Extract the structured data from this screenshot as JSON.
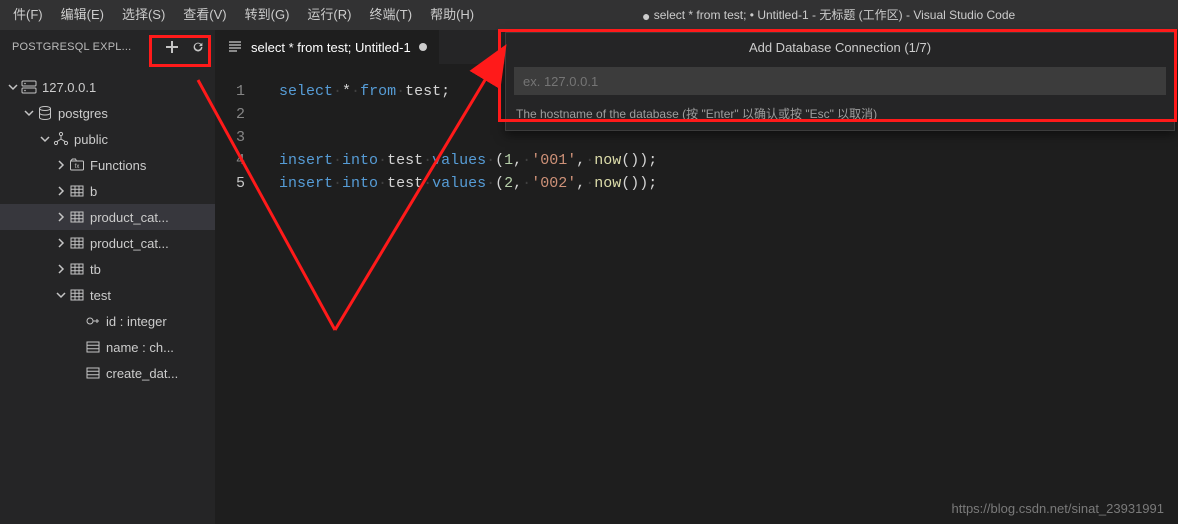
{
  "menubar": {
    "items": [
      "件(F)",
      "编辑(E)",
      "选择(S)",
      "查看(V)",
      "转到(G)",
      "运行(R)",
      "终端(T)",
      "帮助(H)"
    ],
    "title_prefix": "●",
    "title": "select * from test; • Untitled-1 - 无标题 (工作区) - Visual Studio Code"
  },
  "sidebar": {
    "panel_title": "POSTGRESQL EXPL...",
    "add_icon": "plus-icon",
    "tree": [
      {
        "depth": 0,
        "twisty": "down",
        "icon": "server",
        "label": "127.0.0.1"
      },
      {
        "depth": 1,
        "twisty": "down",
        "icon": "database",
        "label": "postgres"
      },
      {
        "depth": 2,
        "twisty": "down",
        "icon": "schema",
        "label": "public"
      },
      {
        "depth": 3,
        "twisty": "right",
        "icon": "folder-fn",
        "label": "Functions"
      },
      {
        "depth": 3,
        "twisty": "right",
        "icon": "table",
        "label": "b"
      },
      {
        "depth": 3,
        "twisty": "right",
        "icon": "table",
        "label": "product_cat...",
        "selected": true
      },
      {
        "depth": 3,
        "twisty": "right",
        "icon": "table",
        "label": "product_cat..."
      },
      {
        "depth": 3,
        "twisty": "right",
        "icon": "table",
        "label": "tb"
      },
      {
        "depth": 3,
        "twisty": "down",
        "icon": "table",
        "label": "test"
      },
      {
        "depth": 4,
        "twisty": "",
        "icon": "key",
        "label": "id : integer"
      },
      {
        "depth": 4,
        "twisty": "",
        "icon": "column",
        "label": "name : ch..."
      },
      {
        "depth": 4,
        "twisty": "",
        "icon": "column",
        "label": "create_dat..."
      }
    ]
  },
  "tabs": {
    "items": [
      {
        "icon": "sql-file",
        "label": "select * from test;  Untitled-1",
        "dirty": true
      }
    ]
  },
  "editor": {
    "lines": [
      {
        "n": 1,
        "tokens": [
          [
            "kw",
            "select"
          ],
          [
            "ws",
            "·"
          ],
          [
            "star",
            "*"
          ],
          [
            "ws",
            "·"
          ],
          [
            "kw",
            "from"
          ],
          [
            "ws",
            "·"
          ],
          [
            "id",
            "test"
          ],
          [
            "p",
            ";"
          ]
        ]
      },
      {
        "n": 2,
        "tokens": []
      },
      {
        "n": 3,
        "tokens": []
      },
      {
        "n": 4,
        "tokens": [
          [
            "kw",
            "insert"
          ],
          [
            "ws",
            "·"
          ],
          [
            "kw",
            "into"
          ],
          [
            "ws",
            "·"
          ],
          [
            "id",
            "test"
          ],
          [
            "ws",
            "·"
          ],
          [
            "kw",
            "values"
          ],
          [
            "ws",
            "·"
          ],
          [
            "p",
            "("
          ],
          [
            "num",
            "1"
          ],
          [
            "p",
            ","
          ],
          [
            "ws",
            "·"
          ],
          [
            "str",
            "'001'"
          ],
          [
            "p",
            ","
          ],
          [
            "ws",
            "·"
          ],
          [
            "fn",
            "now"
          ],
          [
            "p",
            "()"
          ],
          [
            "p",
            ")"
          ],
          [
            "p",
            ";"
          ]
        ]
      },
      {
        "n": 5,
        "tokens": [
          [
            "kw",
            "insert"
          ],
          [
            "ws",
            "·"
          ],
          [
            "kw",
            "into"
          ],
          [
            "ws",
            "·"
          ],
          [
            "id",
            "test"
          ],
          [
            "ws",
            "·"
          ],
          [
            "kw",
            "values"
          ],
          [
            "ws",
            "·"
          ],
          [
            "p",
            "("
          ],
          [
            "num",
            "2"
          ],
          [
            "p",
            ","
          ],
          [
            "ws",
            "·"
          ],
          [
            "str",
            "'002'"
          ],
          [
            "p",
            ","
          ],
          [
            "ws",
            "·"
          ],
          [
            "fn",
            "now"
          ],
          [
            "p",
            "()"
          ],
          [
            "p",
            ")"
          ],
          [
            "p",
            ";"
          ]
        ]
      }
    ]
  },
  "quickinput": {
    "title": "Add Database Connection (1/7)",
    "placeholder": "ex. 127.0.0.1",
    "description": "The hostname of the database (按 \"Enter\" 以确认或按 \"Esc\" 以取消)"
  },
  "watermark": "https://blog.csdn.net/sinat_23931991"
}
